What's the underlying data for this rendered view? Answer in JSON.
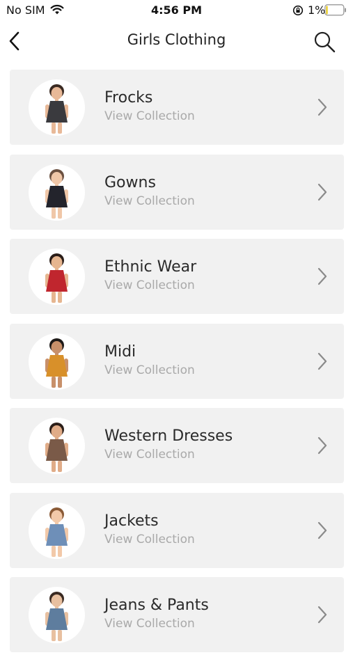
{
  "status_bar": {
    "carrier": "No SIM",
    "time": "4:56 PM",
    "battery": "1%"
  },
  "header": {
    "title": "Girls Clothing"
  },
  "categories": [
    {
      "title": "Frocks",
      "subtitle": "View Collection",
      "outfit_color": "#3a3a3e",
      "skin": "#e8b998",
      "hair": "#3a2a22"
    },
    {
      "title": "Gowns",
      "subtitle": "View Collection",
      "outfit_color": "#23242c",
      "skin": "#f0c7a8",
      "hair": "#6b5040"
    },
    {
      "title": "Ethnic Wear",
      "subtitle": "View Collection",
      "outfit_color": "#c0262e",
      "skin": "#e6b690",
      "hair": "#2a1d18"
    },
    {
      "title": "Midi",
      "subtitle": "View Collection",
      "outfit_color": "#d8902a",
      "skin": "#c8906a",
      "hair": "#1e1a18"
    },
    {
      "title": "Western Dresses",
      "subtitle": "View Collection",
      "outfit_color": "#7a5a48",
      "skin": "#e0ac88",
      "hair": "#2b1e18"
    },
    {
      "title": "Jackets",
      "subtitle": "View Collection",
      "outfit_color": "#6e8fb8",
      "skin": "#f2c9a9",
      "hair": "#8a5a36"
    },
    {
      "title": "Jeans & Pants",
      "subtitle": "View Collection",
      "outfit_color": "#5e7d9e",
      "skin": "#e8c0a0",
      "hair": "#3a2a22"
    }
  ]
}
